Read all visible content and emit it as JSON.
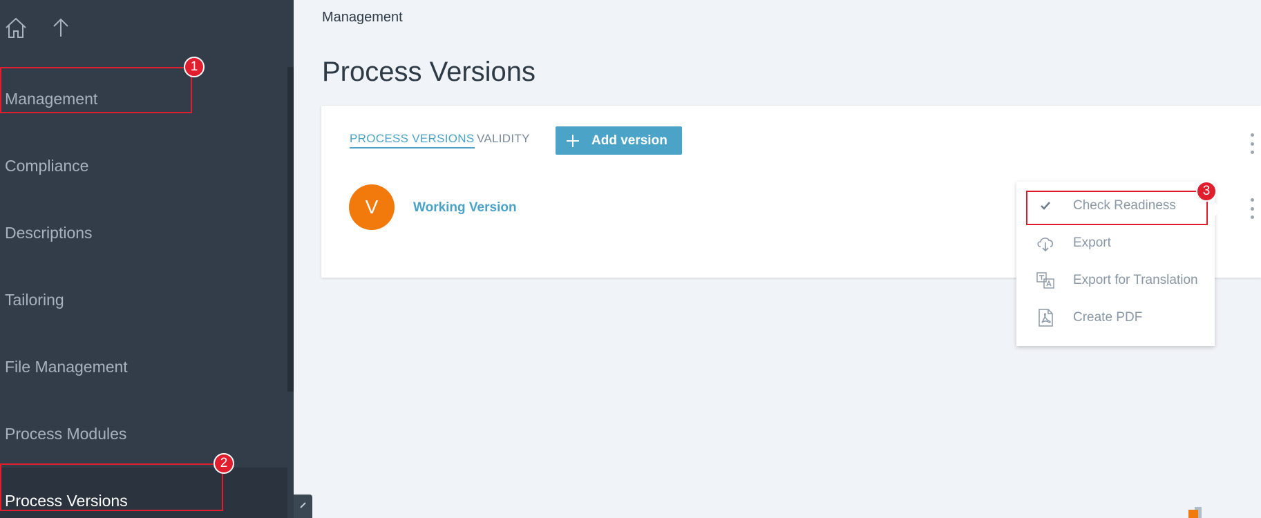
{
  "icons": {
    "home": "home-icon",
    "up": "arrow-up-icon",
    "collapse": "chevron-left-icon",
    "plus": "plus-icon",
    "check": "check-icon",
    "cloud": "cloud-download-icon",
    "translate": "translate-icon",
    "pdf": "pdf-icon"
  },
  "colors": {
    "sidebar": "#323d49",
    "accent": "#4ba4c8",
    "avatar": "#f27a0d",
    "annotation": "#e01e2e"
  },
  "sidebar": {
    "items": [
      {
        "label": "Management"
      },
      {
        "label": "Compliance"
      },
      {
        "label": "Descriptions"
      },
      {
        "label": "Tailoring"
      },
      {
        "label": "File Management"
      },
      {
        "label": "Process Modules"
      },
      {
        "label": "Process Versions"
      }
    ],
    "active": "Process Versions"
  },
  "annotations": {
    "badge1": "1",
    "badge2": "2",
    "badge3": "3"
  },
  "main": {
    "breadcrumb": "Management",
    "title": "Process Versions",
    "tabs": [
      {
        "label": "PROCESS VERSIONS"
      },
      {
        "label": "VALIDITY"
      }
    ],
    "add_button": "Add version",
    "version": {
      "avatar_letter": "V",
      "name": "Working Version"
    }
  },
  "menu": {
    "items": [
      {
        "label": "Check Readiness"
      },
      {
        "label": "Export"
      },
      {
        "label": "Export for Translation"
      },
      {
        "label": "Create PDF"
      }
    ]
  }
}
